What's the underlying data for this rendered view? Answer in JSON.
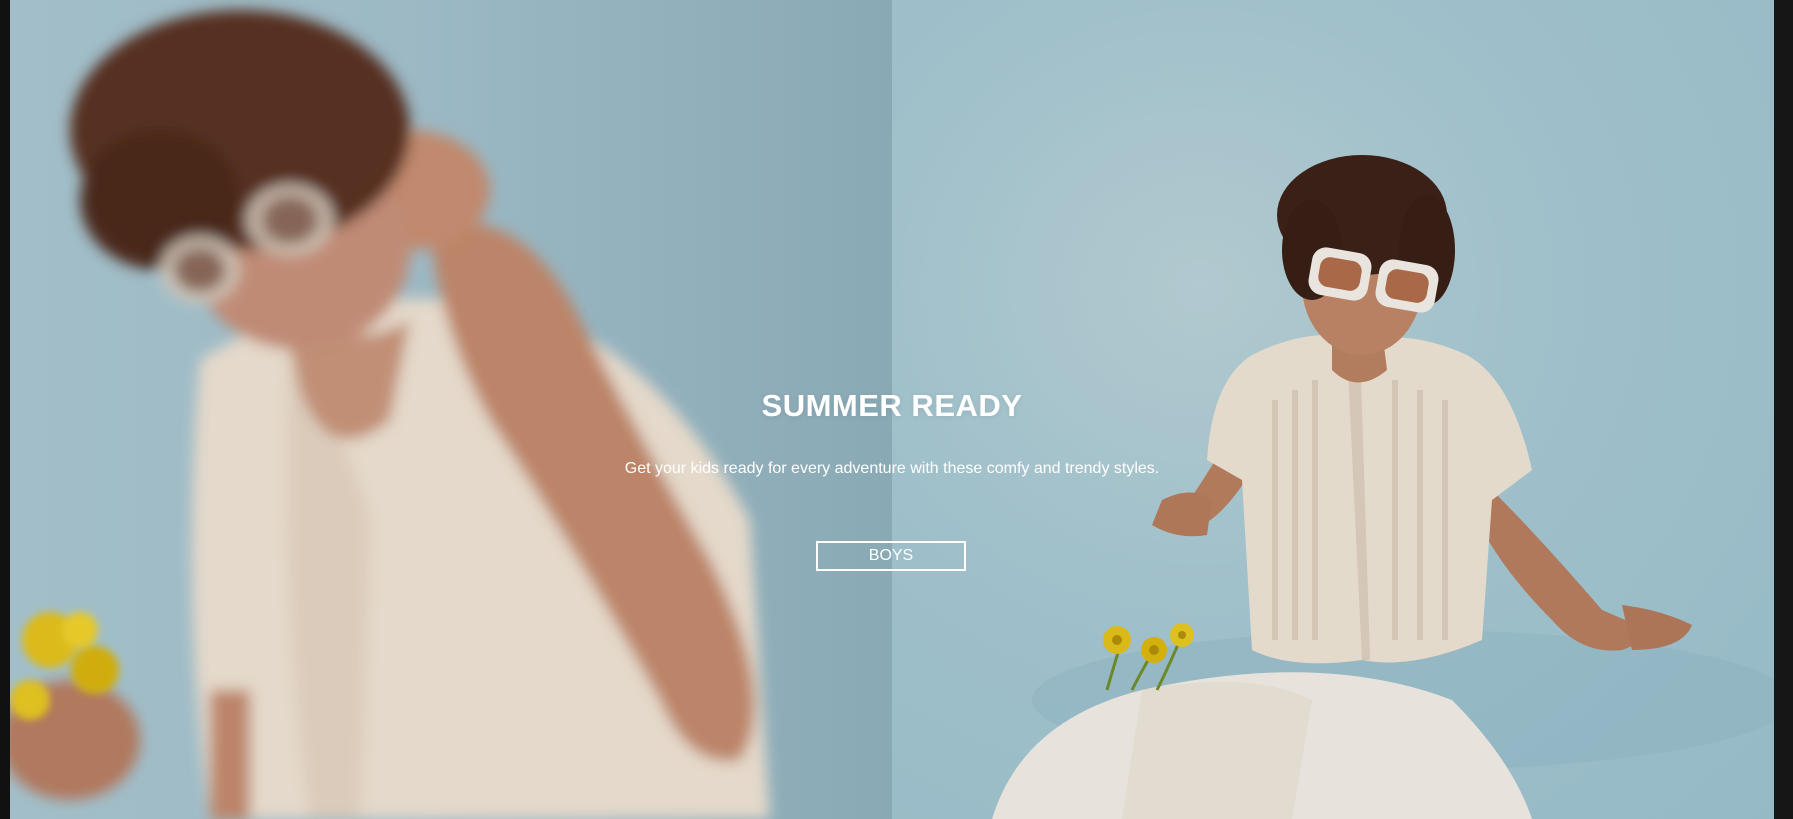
{
  "hero": {
    "title": "SUMMER READY",
    "subtitle": "Get your kids ready for every adventure with these comfy and trendy styles.",
    "cta_label": "BOYS"
  },
  "colors": {
    "backdrop": "#a5c6d1",
    "text": "#ffffff",
    "frame": "#111111"
  },
  "images": {
    "left": "blurred-boy-adjusting-sunglasses-holding-yellow-flowers",
    "right": "boy-in-sunglasses-sitting-on-floor-crochet-shirt"
  }
}
